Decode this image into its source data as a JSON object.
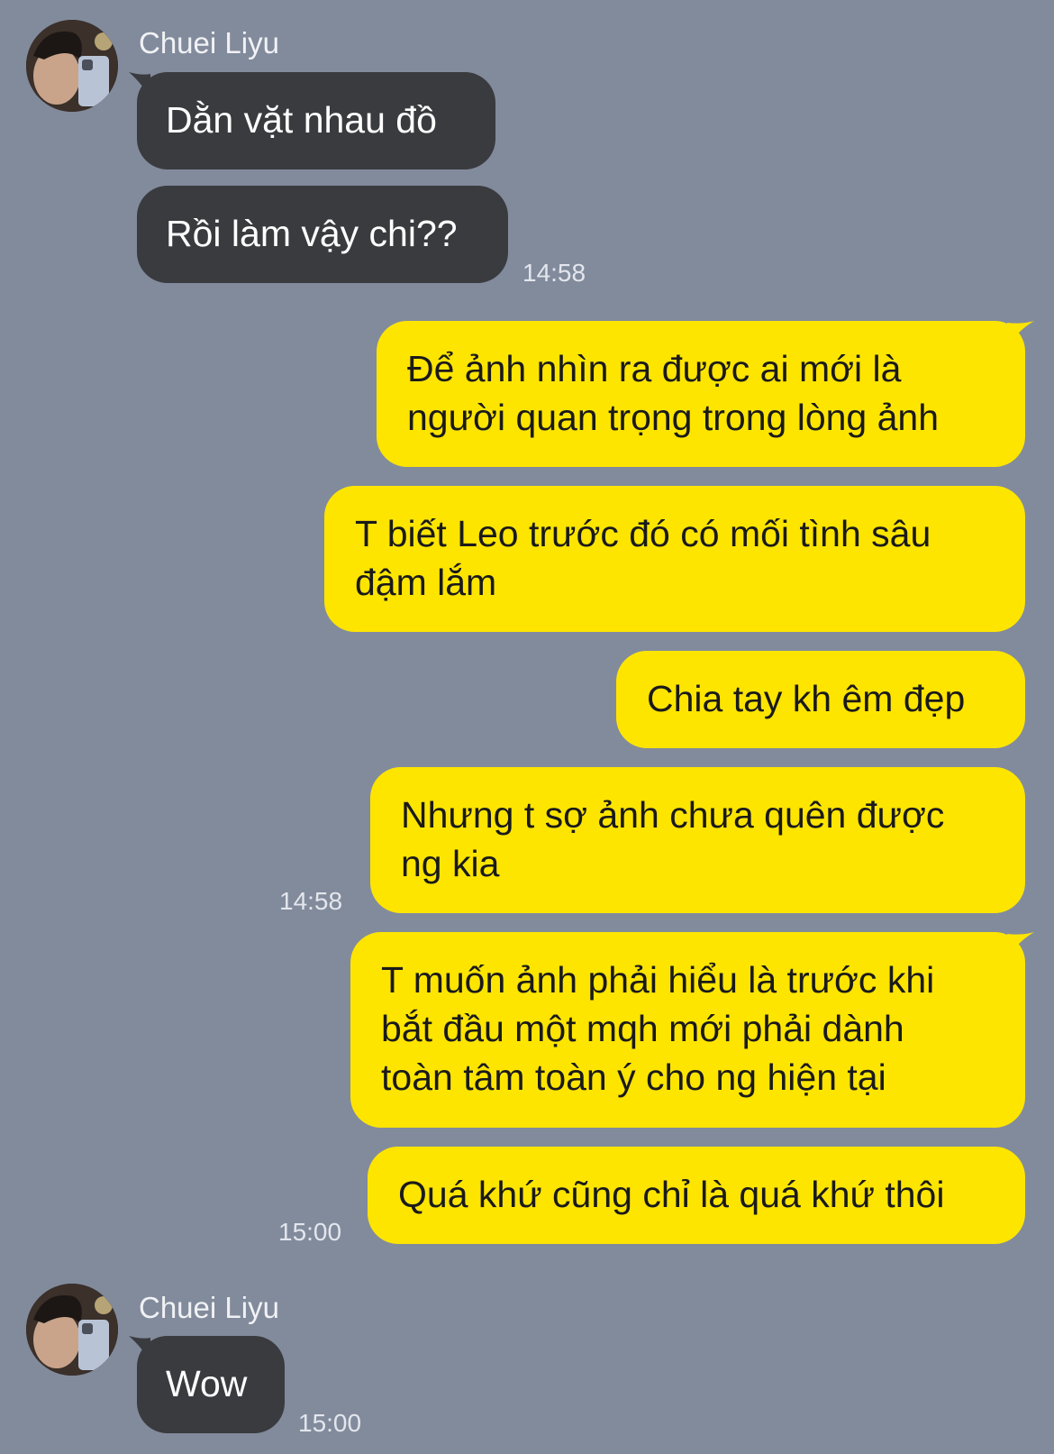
{
  "chat": {
    "messages": [
      {
        "sender": "Chuei Liyu",
        "bubbles": [
          "Dằn vặt nhau đồ",
          "Rồi làm vậy chi??"
        ],
        "time": "14:58"
      },
      {
        "sender": "me",
        "bubbles": [
          [
            "Để ảnh nhìn ra được ai mới là",
            "người quan trọng trong lòng ảnh"
          ],
          [
            "T biết Leo trước đó có mối tình sâu",
            "đậm lắm"
          ],
          [
            "Chia tay kh êm đẹp"
          ],
          [
            "Nhưng t sợ ảnh chưa quên được",
            "ng kia"
          ]
        ],
        "time": "14:58"
      },
      {
        "sender": "me",
        "bubbles": [
          [
            "T muốn ảnh phải hiểu là trước khi",
            "bắt đầu một mqh mới phải dành",
            "toàn tâm toàn ý cho ng hiện tại"
          ],
          [
            "Quá khứ cũng chỉ là quá khứ thôi"
          ]
        ],
        "time": "15:00"
      },
      {
        "sender": "Chuei Liyu",
        "bubbles": [
          "Wow"
        ],
        "time": "15:00"
      }
    ]
  },
  "colors": {
    "background": "#828b9c",
    "incoming_bubble": "#3a3b3f",
    "outgoing_bubble": "#fee500"
  }
}
